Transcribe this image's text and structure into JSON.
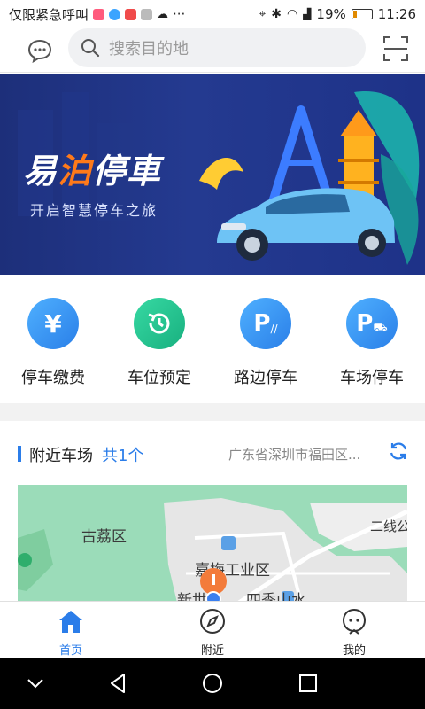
{
  "status_bar": {
    "carrier_text": "仅限紧急呼叫",
    "more": "···",
    "battery": "19%",
    "battery_level": 0.19,
    "time": "11:26"
  },
  "search": {
    "placeholder": "搜索目的地"
  },
  "banner": {
    "logo_part1": "易",
    "logo_part2": "泊",
    "logo_part3": "停車",
    "slogan": "开启智慧停车之旅"
  },
  "actions": [
    {
      "label": "停车缴费",
      "icon": "yen-icon",
      "color": "#2e8ff0"
    },
    {
      "label": "车位预定",
      "icon": "history-icon",
      "color": "#22c08a"
    },
    {
      "label": "路边停车",
      "icon": "roadside-parking-icon",
      "color": "#2e8ff0"
    },
    {
      "label": "车场停车",
      "icon": "parking-car-icon",
      "color": "#2e8ff0"
    }
  ],
  "nearby": {
    "title": "附近车场",
    "count": "共1个",
    "address": "广东省深圳市福田区..."
  },
  "map": {
    "district": "古荔区",
    "road": "二线公",
    "poi_1": "嘉梅工业区",
    "poi_2": "新世",
    "poi_3": "四季山水"
  },
  "tabs": [
    {
      "label": "首页",
      "icon": "home-icon",
      "active": true
    },
    {
      "label": "附近",
      "icon": "compass-icon",
      "active": false
    },
    {
      "label": "我的",
      "icon": "profile-icon",
      "active": false
    }
  ],
  "colors": {
    "accent": "#2b7de9",
    "banner_bg": "#1d2f7a",
    "logo_accent": "#ff7a1a"
  }
}
